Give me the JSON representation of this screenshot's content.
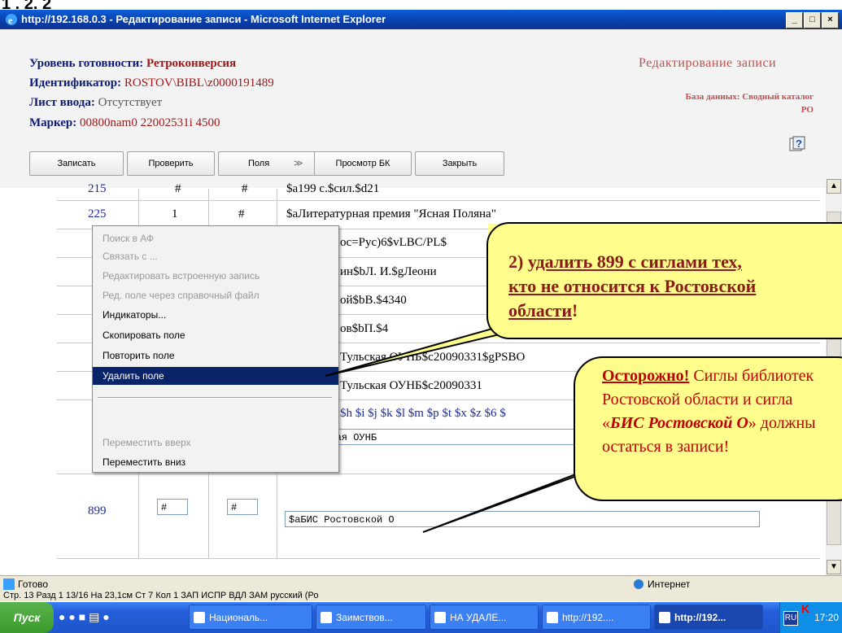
{
  "slide_label": "1 . 2. 2",
  "window": {
    "title": "http://192.168.0.3 - Редактирование записи - Microsoft Internet Explorer"
  },
  "header": {
    "readiness_label": "Уровень готовности:",
    "readiness_value": "Ретроконверсия",
    "identifier_label": "Идентификатор:",
    "identifier_value": "ROSTOV\\BIBL\\z0000191489",
    "sheet_label": "Лист ввода:",
    "sheet_value": "Отсутствует",
    "marker_label": "Маркер:",
    "marker_value": "00800nam0 22002531i 4500",
    "right_title": "Редактирование записи",
    "db_line1": "База данных: Сводный каталог",
    "db_line2": "РО"
  },
  "toolbar": {
    "save": "Записать",
    "check": "Проверить",
    "fields": "Поля",
    "fields_arrow": "≫",
    "preview": "Просмотр БК",
    "close": "Закрыть"
  },
  "rows": [
    {
      "tag": "215",
      "i1": "#",
      "i2": "#",
      "value": "$a199 с.$cил.$d21"
    },
    {
      "tag": "225",
      "i1": "1",
      "i2": "#",
      "value": "$aЛитературная премия \"Ясная Поляна\""
    },
    {
      "value": "oc=Рус)6$vLBC/PL$"
    },
    {
      "value": "ин$bЛ. И.$gЛеони"
    },
    {
      "value": "ой$bВ.$4340"
    },
    {
      "value": "ов$bП.$4"
    },
    {
      "value": "Тульская ОУНБ$c20090331$gPSBO"
    },
    {
      "value": "Тульская ОУНБ$c20090331"
    },
    {
      "value": "$h $i $j $k $l $m $p $t $x $z $6 $"
    },
    {
      "input": "$aТульская ОУНБ"
    },
    {
      "tag": "899",
      "i1": "#",
      "i2": "#",
      "input": "$aБИС Ростовской О"
    }
  ],
  "context_menu": [
    {
      "label": "Поиск в АФ",
      "disabled": true
    },
    {
      "label": "Связать с ...",
      "disabled": true
    },
    {
      "label": "Редактировать встроенную запись",
      "disabled": true
    },
    {
      "label": "Ред. поле через справочный файл",
      "disabled": true
    },
    {
      "label": "Индикаторы...",
      "disabled": false
    },
    {
      "label": "Скопировать поле",
      "disabled": false
    },
    {
      "label": "Повторить поле",
      "disabled": false
    },
    {
      "label": "Удалить поле",
      "disabled": false,
      "selected": true
    },
    {
      "label": "Переместить вверх",
      "disabled": true
    },
    {
      "label": "Переместить вниз",
      "disabled": false
    }
  ],
  "callout1": {
    "line1_prefix": "2) ",
    "line1": "удалить 899 с сиглами тех,",
    "line2": "кто не относится к Ростовской",
    "line3": "области",
    "line3_suffix": "!"
  },
  "callout2": {
    "warn": "Осторожно!",
    "warn_rest": " Сиглы библиотек",
    "line2": "Ростовской области и сигла",
    "line3_open": "«",
    "line3_em": "БИС Ростовской О",
    "line3_close": "» должны",
    "line4": "остаться в записи!"
  },
  "status": {
    "text": "Готово",
    "zone": "Интернет"
  },
  "word_status": "Стр. 13     Разд 1     13/16     На 23,1см  Ст 7    Кол 1          ЗАП  ИСПР  ВДЛ  ЗАМ  русский (Ро",
  "taskbar": {
    "start": "Пуск",
    "items": [
      "Националь...",
      "Заимствов...",
      "НА УДАЛЕ...",
      "http://192....",
      "http://192..."
    ],
    "lang": "RU",
    "clock": "17:20"
  }
}
